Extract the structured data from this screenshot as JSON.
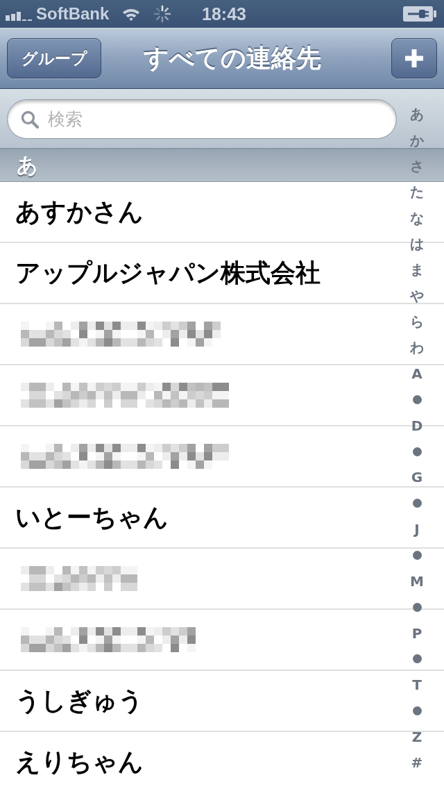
{
  "status_bar": {
    "carrier": "SoftBank",
    "time": "18:43"
  },
  "nav_bar": {
    "left_button": "グループ",
    "title": "すべての連絡先"
  },
  "search": {
    "placeholder": "検索"
  },
  "sections": [
    {
      "header": "あ",
      "rows": [
        {
          "kind": "name",
          "name": "あすかさん"
        },
        {
          "kind": "name",
          "name": "アップルジャパン株式会社"
        },
        {
          "kind": "redacted"
        },
        {
          "kind": "redacted"
        },
        {
          "kind": "redacted"
        },
        {
          "kind": "name",
          "name": "いとーちゃん"
        },
        {
          "kind": "redacted"
        },
        {
          "kind": "redacted"
        },
        {
          "kind": "name",
          "name": "うしぎゅう"
        },
        {
          "kind": "name",
          "name": "えりちゃん"
        }
      ]
    }
  ],
  "index": [
    {
      "kind": "letter",
      "label": "あ"
    },
    {
      "kind": "letter",
      "label": "か"
    },
    {
      "kind": "letter",
      "label": "さ"
    },
    {
      "kind": "letter",
      "label": "た"
    },
    {
      "kind": "letter",
      "label": "な"
    },
    {
      "kind": "letter",
      "label": "は"
    },
    {
      "kind": "letter",
      "label": "ま"
    },
    {
      "kind": "letter",
      "label": "や"
    },
    {
      "kind": "letter",
      "label": "ら"
    },
    {
      "kind": "letter",
      "label": "わ"
    },
    {
      "kind": "letter",
      "label": "A"
    },
    {
      "kind": "dot"
    },
    {
      "kind": "letter",
      "label": "D"
    },
    {
      "kind": "dot"
    },
    {
      "kind": "letter",
      "label": "G"
    },
    {
      "kind": "dot"
    },
    {
      "kind": "letter",
      "label": "J"
    },
    {
      "kind": "dot"
    },
    {
      "kind": "letter",
      "label": "M"
    },
    {
      "kind": "dot"
    },
    {
      "kind": "letter",
      "label": "P"
    },
    {
      "kind": "dot"
    },
    {
      "kind": "letter",
      "label": "T"
    },
    {
      "kind": "dot"
    },
    {
      "kind": "letter",
      "label": "Z"
    },
    {
      "kind": "letter",
      "label": "#"
    }
  ]
}
